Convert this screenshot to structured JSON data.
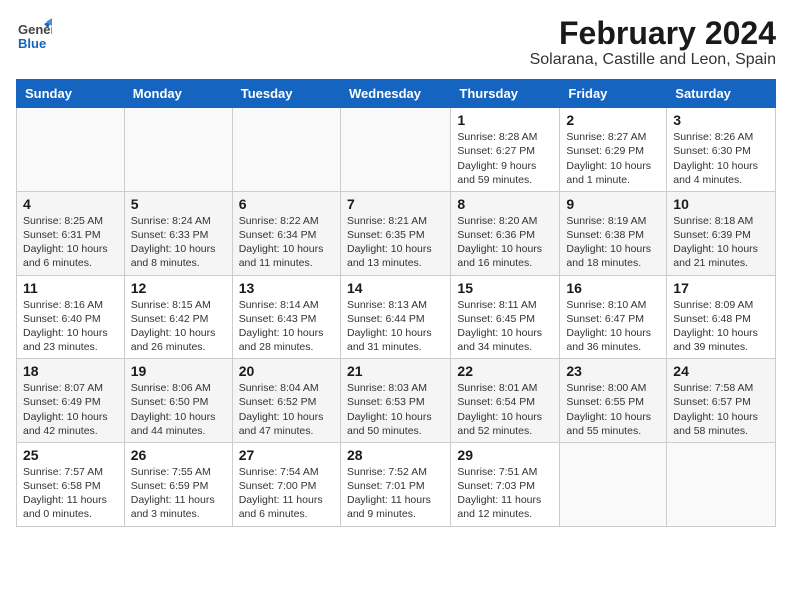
{
  "header": {
    "logo": {
      "general": "General",
      "blue": "Blue"
    },
    "title": "February 2024",
    "subtitle": "Solarana, Castille and Leon, Spain"
  },
  "weekdays": [
    "Sunday",
    "Monday",
    "Tuesday",
    "Wednesday",
    "Thursday",
    "Friday",
    "Saturday"
  ],
  "weeks": [
    [
      {
        "day": "",
        "sunrise": "",
        "sunset": "",
        "daylight": ""
      },
      {
        "day": "",
        "sunrise": "",
        "sunset": "",
        "daylight": ""
      },
      {
        "day": "",
        "sunrise": "",
        "sunset": "",
        "daylight": ""
      },
      {
        "day": "",
        "sunrise": "",
        "sunset": "",
        "daylight": ""
      },
      {
        "day": "1",
        "sunrise": "Sunrise: 8:28 AM",
        "sunset": "Sunset: 6:27 PM",
        "daylight": "Daylight: 9 hours and 59 minutes."
      },
      {
        "day": "2",
        "sunrise": "Sunrise: 8:27 AM",
        "sunset": "Sunset: 6:29 PM",
        "daylight": "Daylight: 10 hours and 1 minute."
      },
      {
        "day": "3",
        "sunrise": "Sunrise: 8:26 AM",
        "sunset": "Sunset: 6:30 PM",
        "daylight": "Daylight: 10 hours and 4 minutes."
      }
    ],
    [
      {
        "day": "4",
        "sunrise": "Sunrise: 8:25 AM",
        "sunset": "Sunset: 6:31 PM",
        "daylight": "Daylight: 10 hours and 6 minutes."
      },
      {
        "day": "5",
        "sunrise": "Sunrise: 8:24 AM",
        "sunset": "Sunset: 6:33 PM",
        "daylight": "Daylight: 10 hours and 8 minutes."
      },
      {
        "day": "6",
        "sunrise": "Sunrise: 8:22 AM",
        "sunset": "Sunset: 6:34 PM",
        "daylight": "Daylight: 10 hours and 11 minutes."
      },
      {
        "day": "7",
        "sunrise": "Sunrise: 8:21 AM",
        "sunset": "Sunset: 6:35 PM",
        "daylight": "Daylight: 10 hours and 13 minutes."
      },
      {
        "day": "8",
        "sunrise": "Sunrise: 8:20 AM",
        "sunset": "Sunset: 6:36 PM",
        "daylight": "Daylight: 10 hours and 16 minutes."
      },
      {
        "day": "9",
        "sunrise": "Sunrise: 8:19 AM",
        "sunset": "Sunset: 6:38 PM",
        "daylight": "Daylight: 10 hours and 18 minutes."
      },
      {
        "day": "10",
        "sunrise": "Sunrise: 8:18 AM",
        "sunset": "Sunset: 6:39 PM",
        "daylight": "Daylight: 10 hours and 21 minutes."
      }
    ],
    [
      {
        "day": "11",
        "sunrise": "Sunrise: 8:16 AM",
        "sunset": "Sunset: 6:40 PM",
        "daylight": "Daylight: 10 hours and 23 minutes."
      },
      {
        "day": "12",
        "sunrise": "Sunrise: 8:15 AM",
        "sunset": "Sunset: 6:42 PM",
        "daylight": "Daylight: 10 hours and 26 minutes."
      },
      {
        "day": "13",
        "sunrise": "Sunrise: 8:14 AM",
        "sunset": "Sunset: 6:43 PM",
        "daylight": "Daylight: 10 hours and 28 minutes."
      },
      {
        "day": "14",
        "sunrise": "Sunrise: 8:13 AM",
        "sunset": "Sunset: 6:44 PM",
        "daylight": "Daylight: 10 hours and 31 minutes."
      },
      {
        "day": "15",
        "sunrise": "Sunrise: 8:11 AM",
        "sunset": "Sunset: 6:45 PM",
        "daylight": "Daylight: 10 hours and 34 minutes."
      },
      {
        "day": "16",
        "sunrise": "Sunrise: 8:10 AM",
        "sunset": "Sunset: 6:47 PM",
        "daylight": "Daylight: 10 hours and 36 minutes."
      },
      {
        "day": "17",
        "sunrise": "Sunrise: 8:09 AM",
        "sunset": "Sunset: 6:48 PM",
        "daylight": "Daylight: 10 hours and 39 minutes."
      }
    ],
    [
      {
        "day": "18",
        "sunrise": "Sunrise: 8:07 AM",
        "sunset": "Sunset: 6:49 PM",
        "daylight": "Daylight: 10 hours and 42 minutes."
      },
      {
        "day": "19",
        "sunrise": "Sunrise: 8:06 AM",
        "sunset": "Sunset: 6:50 PM",
        "daylight": "Daylight: 10 hours and 44 minutes."
      },
      {
        "day": "20",
        "sunrise": "Sunrise: 8:04 AM",
        "sunset": "Sunset: 6:52 PM",
        "daylight": "Daylight: 10 hours and 47 minutes."
      },
      {
        "day": "21",
        "sunrise": "Sunrise: 8:03 AM",
        "sunset": "Sunset: 6:53 PM",
        "daylight": "Daylight: 10 hours and 50 minutes."
      },
      {
        "day": "22",
        "sunrise": "Sunrise: 8:01 AM",
        "sunset": "Sunset: 6:54 PM",
        "daylight": "Daylight: 10 hours and 52 minutes."
      },
      {
        "day": "23",
        "sunrise": "Sunrise: 8:00 AM",
        "sunset": "Sunset: 6:55 PM",
        "daylight": "Daylight: 10 hours and 55 minutes."
      },
      {
        "day": "24",
        "sunrise": "Sunrise: 7:58 AM",
        "sunset": "Sunset: 6:57 PM",
        "daylight": "Daylight: 10 hours and 58 minutes."
      }
    ],
    [
      {
        "day": "25",
        "sunrise": "Sunrise: 7:57 AM",
        "sunset": "Sunset: 6:58 PM",
        "daylight": "Daylight: 11 hours and 0 minutes."
      },
      {
        "day": "26",
        "sunrise": "Sunrise: 7:55 AM",
        "sunset": "Sunset: 6:59 PM",
        "daylight": "Daylight: 11 hours and 3 minutes."
      },
      {
        "day": "27",
        "sunrise": "Sunrise: 7:54 AM",
        "sunset": "Sunset: 7:00 PM",
        "daylight": "Daylight: 11 hours and 6 minutes."
      },
      {
        "day": "28",
        "sunrise": "Sunrise: 7:52 AM",
        "sunset": "Sunset: 7:01 PM",
        "daylight": "Daylight: 11 hours and 9 minutes."
      },
      {
        "day": "29",
        "sunrise": "Sunrise: 7:51 AM",
        "sunset": "Sunset: 7:03 PM",
        "daylight": "Daylight: 11 hours and 12 minutes."
      },
      {
        "day": "",
        "sunrise": "",
        "sunset": "",
        "daylight": ""
      },
      {
        "day": "",
        "sunrise": "",
        "sunset": "",
        "daylight": ""
      }
    ]
  ]
}
